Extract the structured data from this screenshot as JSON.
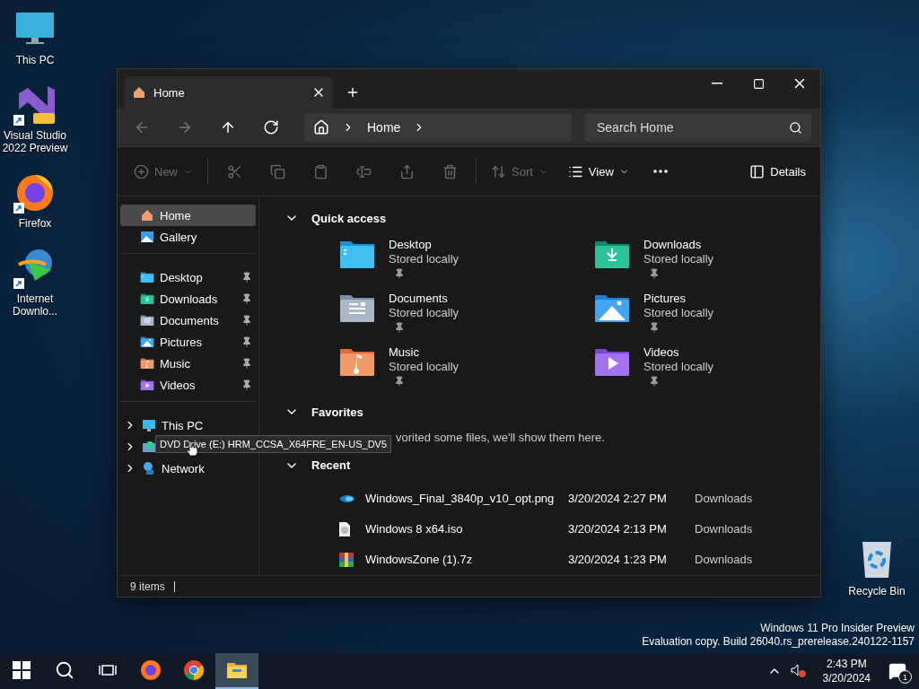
{
  "desktop_icons": [
    {
      "label": "This PC",
      "kind": "pc"
    },
    {
      "label": "Visual Studio 2022 Preview",
      "kind": "vs",
      "shortcut": true
    },
    {
      "label": "Firefox",
      "kind": "firefox",
      "shortcut": true
    },
    {
      "label": "Internet Downlo...",
      "kind": "idm",
      "shortcut": true
    }
  ],
  "recycle_bin": {
    "label": "Recycle Bin"
  },
  "os_notice": [
    "Windows 11 Pro Insider Preview",
    "Evaluation copy. Build 26040.rs_prerelease.240122-1157"
  ],
  "explorer": {
    "tabs": [
      {
        "label": "Home",
        "selected": true
      }
    ],
    "nav": [
      {
        "kind": "back",
        "disabled": true
      },
      {
        "kind": "forward",
        "disabled": true
      },
      {
        "kind": "up",
        "disabled": false
      },
      {
        "kind": "refresh",
        "disabled": false
      }
    ],
    "breadcrumb": [
      "Home"
    ],
    "search": {
      "placeholder": "Search Home"
    },
    "toolbar_groups": [
      [
        {
          "kind": "new",
          "label": "New",
          "disabled": true,
          "dropdown": true
        }
      ],
      [
        {
          "kind": "cut",
          "disabled": true
        },
        {
          "kind": "copy",
          "disabled": true
        },
        {
          "kind": "paste",
          "disabled": true
        },
        {
          "kind": "rename",
          "disabled": true
        },
        {
          "kind": "share",
          "disabled": true
        },
        {
          "kind": "delete",
          "disabled": true
        }
      ],
      [
        {
          "kind": "sort",
          "label": "Sort",
          "disabled": true,
          "dropdown": true
        },
        {
          "kind": "view",
          "label": "View",
          "disabled": false,
          "dropdown": true
        },
        {
          "kind": "more",
          "disabled": false
        }
      ]
    ],
    "details_button": {
      "label": "Details"
    },
    "sidebar_groups": [
      [
        {
          "label": "Home",
          "kind": "home",
          "selected": true
        },
        {
          "label": "Gallery",
          "kind": "gallery",
          "selected": false
        }
      ],
      [
        {
          "label": "Desktop",
          "kind": "desktop",
          "selected": false,
          "pinned": true
        },
        {
          "label": "Downloads",
          "kind": "downloads",
          "selected": false,
          "pinned": true
        },
        {
          "label": "Documents",
          "kind": "documents",
          "selected": false,
          "pinned": true
        },
        {
          "label": "Pictures",
          "kind": "pictures",
          "selected": false,
          "pinned": true
        },
        {
          "label": "Music",
          "kind": "music",
          "selected": false,
          "pinned": true
        },
        {
          "label": "Videos",
          "kind": "videos",
          "selected": false,
          "pinned": true
        }
      ],
      [
        {
          "label": "This PC",
          "kind": "pc",
          "selected": false,
          "expanded": false
        },
        {
          "kind": "dvd",
          "selected": false,
          "expanded": false
        },
        {
          "label": "Network",
          "kind": "network",
          "selected": false,
          "expanded": false
        }
      ]
    ],
    "tooltip": {
      "text": "DVD Drive (E:) HRM_CCSA_X64FRE_EN-US_DV5"
    },
    "quick_access": {
      "title": "Quick access",
      "expanded": true,
      "items": [
        {
          "name": "Desktop",
          "status": "Stored locally",
          "kind": "desktop",
          "pinned": true
        },
        {
          "name": "Downloads",
          "status": "Stored locally",
          "kind": "downloads",
          "pinned": true
        },
        {
          "name": "Documents",
          "status": "Stored locally",
          "kind": "documents",
          "pinned": true
        },
        {
          "name": "Pictures",
          "status": "Stored locally",
          "kind": "pictures",
          "pinned": true
        },
        {
          "name": "Music",
          "status": "Stored locally",
          "kind": "music",
          "pinned": true
        },
        {
          "name": "Videos",
          "status": "Stored locally",
          "kind": "videos",
          "pinned": true
        }
      ]
    },
    "favorites": {
      "title": "Favorites",
      "expanded": true,
      "message": "vorited some files, we'll show them here."
    },
    "recent": {
      "title": "Recent",
      "expanded": true,
      "rows": [
        {
          "name": "Windows_Final_3840p_v10_opt.png",
          "date": "3/20/2024 2:27 PM",
          "location": "Downloads",
          "kind": "image"
        },
        {
          "name": "Windows 8 x64.iso",
          "date": "3/20/2024 2:13 PM",
          "location": "Downloads",
          "kind": "disc"
        },
        {
          "name": "WindowsZone (1).7z",
          "date": "3/20/2024 1:23 PM",
          "location": "Downloads",
          "kind": "archive"
        }
      ]
    },
    "status_bar": {
      "count": "9 items"
    }
  },
  "taskbar": {
    "apps": [
      {
        "kind": "start",
        "selected": false
      },
      {
        "kind": "search",
        "selected": false
      },
      {
        "kind": "taskview",
        "selected": false
      },
      {
        "kind": "firefox",
        "selected": false
      },
      {
        "kind": "chrome",
        "selected": false
      },
      {
        "kind": "explorer",
        "selected": true
      }
    ],
    "time": "2:43 PM",
    "date": "3/20/2024",
    "notifications": "1"
  }
}
